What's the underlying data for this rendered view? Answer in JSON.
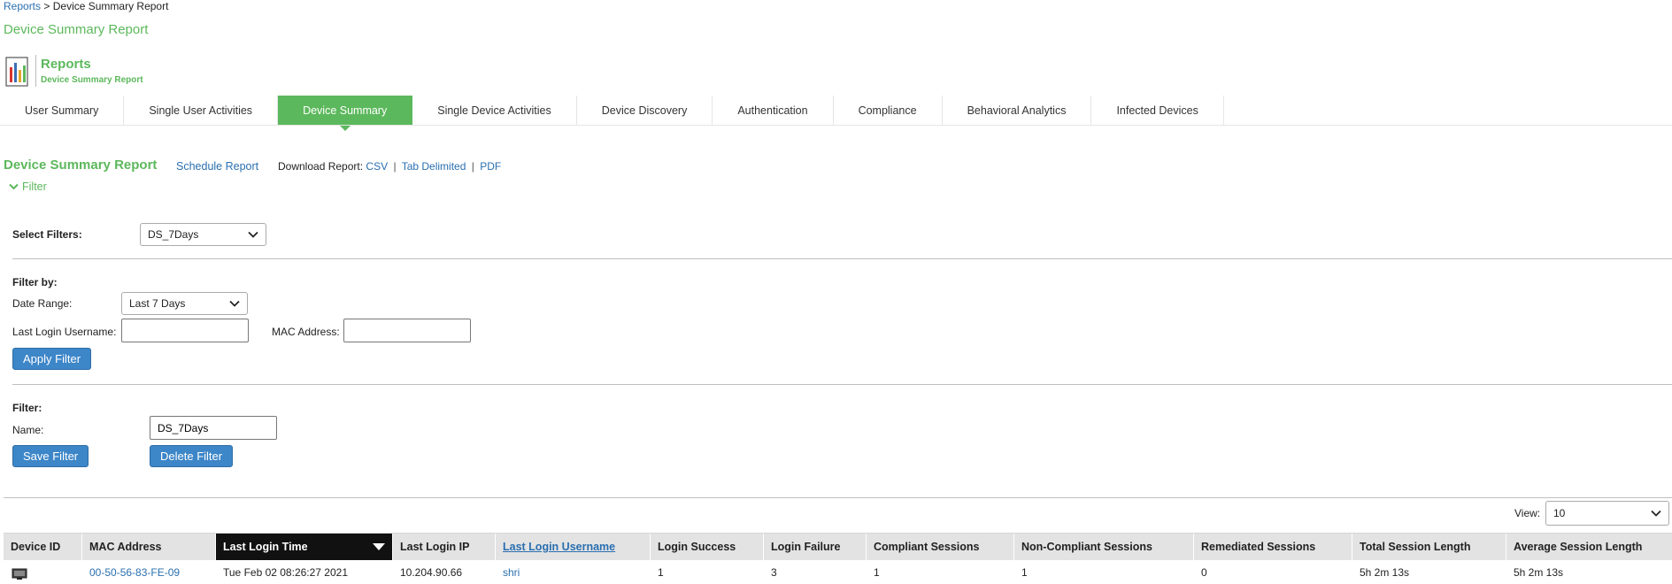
{
  "breadcrumb": {
    "root": "Reports",
    "separator": ">",
    "current": "Device Summary Report"
  },
  "page_title": "Device Summary Report",
  "header": {
    "title": "Reports",
    "subtitle": "Device Summary Report"
  },
  "tabs": [
    {
      "label": "User Summary"
    },
    {
      "label": "Single User Activities"
    },
    {
      "label": "Device Summary",
      "active": true
    },
    {
      "label": "Single Device Activities"
    },
    {
      "label": "Device Discovery"
    },
    {
      "label": "Authentication"
    },
    {
      "label": "Compliance"
    },
    {
      "label": "Behavioral Analytics"
    },
    {
      "label": "Infected Devices"
    }
  ],
  "report": {
    "title": "Device Summary Report",
    "schedule_label": "Schedule Report",
    "download_label": "Download Report:",
    "download_csv": "CSV",
    "download_tab": "Tab Delimited",
    "download_pdf": "PDF",
    "sep": "|"
  },
  "filter_toggle": "Filter",
  "select_filters": {
    "label": "Select Filters:",
    "value": "DS_7Days"
  },
  "filter_by": {
    "heading": "Filter by:",
    "date_range_label": "Date Range:",
    "date_range_value": "Last 7 Days",
    "username_label": "Last Login Username:",
    "username_value": "",
    "mac_label": "MAC Address:",
    "mac_value": "",
    "apply_label": "Apply Filter"
  },
  "saved_filter": {
    "heading": "Filter:",
    "name_label": "Name:",
    "name_value": "DS_7Days",
    "save_label": "Save Filter",
    "delete_label": "Delete Filter"
  },
  "view": {
    "label": "View:",
    "value": "10"
  },
  "table": {
    "columns": [
      "Device ID",
      "MAC Address",
      "Last Login Time",
      "Last Login IP",
      "Last Login Username",
      "Login Success",
      "Login Failure",
      "Compliant Sessions",
      "Non-Compliant Sessions",
      "Remediated Sessions",
      "Total Session Length",
      "Average Session Length"
    ],
    "rows": [
      {
        "mac": "00-50-56-83-FE-09",
        "last_login_time": "Tue Feb 02 08:26:27 2021",
        "last_login_ip": "10.204.90.66",
        "username": "shri",
        "login_success": "1",
        "login_failure": "3",
        "compliant": "1",
        "non_compliant": "1",
        "remediated": "0",
        "total_length": "5h 2m 13s",
        "avg_length": "5h 2m 13s"
      }
    ]
  },
  "colors": {
    "brand_green": "#5cb85c",
    "button_blue": "#3d86c8",
    "link_blue": "#2a6fb0"
  }
}
